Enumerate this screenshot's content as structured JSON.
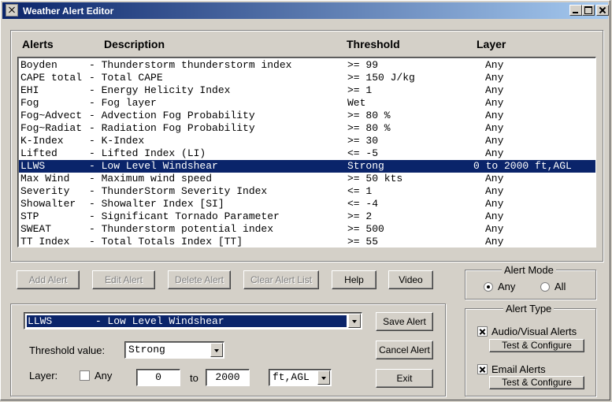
{
  "window": {
    "title": "Weather Alert Editor"
  },
  "columns": {
    "alerts": "Alerts",
    "description": "Description",
    "threshold": "Threshold",
    "layer": "Layer"
  },
  "alerts": [
    {
      "name": "Boyden",
      "desc": "- Thunderstorm thunderstorm index",
      "threshold": ">= 99",
      "layer": "Any"
    },
    {
      "name": "CAPE total",
      "desc": "- Total CAPE",
      "threshold": ">= 150 J/kg",
      "layer": "Any"
    },
    {
      "name": "EHI",
      "desc": "- Energy Helicity Index",
      "threshold": ">= 1",
      "layer": "Any"
    },
    {
      "name": "Fog",
      "desc": "- Fog layer",
      "threshold": "Wet",
      "layer": "Any"
    },
    {
      "name": "Fog~Advect",
      "desc": "- Advection Fog Probability",
      "threshold": ">= 80 %",
      "layer": "Any"
    },
    {
      "name": "Fog~Radiat",
      "desc": "- Radiation Fog Probability",
      "threshold": ">= 80 %",
      "layer": "Any"
    },
    {
      "name": "K-Index",
      "desc": "- K-Index",
      "threshold": ">= 30",
      "layer": "Any"
    },
    {
      "name": "Lifted",
      "desc": "- Lifted Index (LI)",
      "threshold": "<= -5",
      "layer": "Any"
    },
    {
      "name": "LLWS",
      "desc": "- Low Level Windshear",
      "threshold": "Strong",
      "layer": "0 to 2000 ft,AGL",
      "selected": true
    },
    {
      "name": "Max Wind",
      "desc": "- Maximum wind speed",
      "threshold": ">= 50 kts",
      "layer": "Any"
    },
    {
      "name": "Severity",
      "desc": "- ThunderStorm Severity Index",
      "threshold": "<= 1",
      "layer": "Any"
    },
    {
      "name": "Showalter",
      "desc": "- Showalter Index [SI]",
      "threshold": "<= -4",
      "layer": "Any"
    },
    {
      "name": "STP",
      "desc": "- Significant Tornado Parameter",
      "threshold": ">= 2",
      "layer": "Any"
    },
    {
      "name": "SWEAT",
      "desc": "- Thunderstorm potential index",
      "threshold": ">= 500",
      "layer": "Any"
    },
    {
      "name": "TT Index",
      "desc": "- Total Totals Index [TT]",
      "threshold": ">= 55",
      "layer": "Any"
    }
  ],
  "buttons": {
    "add_alert": "Add Alert",
    "edit_alert": "Edit Alert",
    "delete_alert": "Delete Alert",
    "clear_alert_list": "Clear Alert List",
    "help": "Help",
    "video": "Video",
    "save_alert": "Save Alert",
    "cancel_alert": "Cancel Alert",
    "exit": "Exit"
  },
  "editor": {
    "alert_select": "LLWS       - Low Level Windshear",
    "threshold_label": "Threshold value:",
    "threshold_value": "Strong",
    "layer_label": "Layer:",
    "any_label": "Any",
    "any_checked": false,
    "from_value": "0",
    "to_label": "to",
    "to_value": "2000",
    "unit_value": "ft,AGL"
  },
  "alert_mode": {
    "legend": "Alert Mode",
    "any": "Any",
    "all": "All",
    "selected": "Any"
  },
  "alert_type": {
    "legend": "Alert Type",
    "audio_visual": "Audio/Visual Alerts",
    "audio_visual_checked": true,
    "email": "Email Alerts",
    "email_checked": true,
    "test_configure": "Test & Configure"
  }
}
